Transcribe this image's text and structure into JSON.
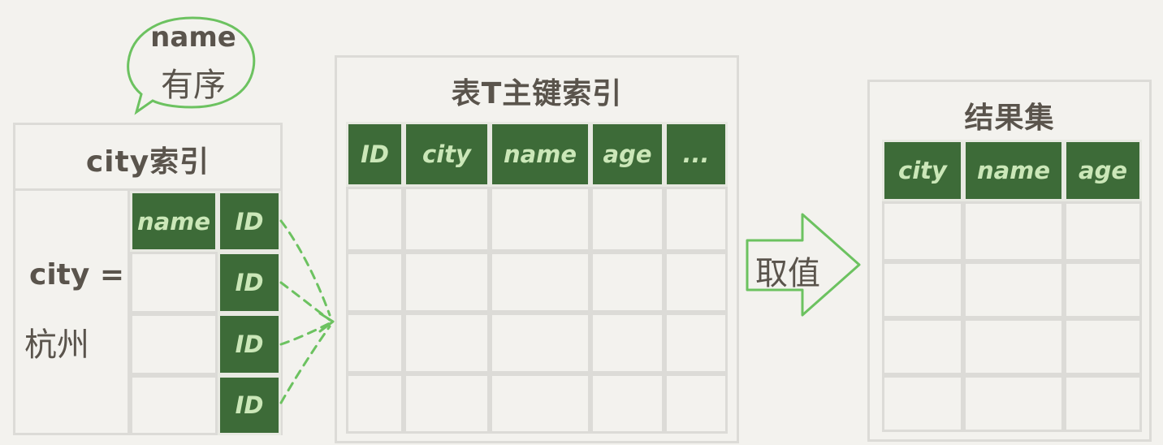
{
  "bubble": {
    "line1": "name",
    "line2": "有序"
  },
  "city_index": {
    "title": "city索引",
    "condition_line1": "city =",
    "condition_line2": "杭州",
    "header": [
      "name",
      "ID"
    ],
    "id_cells": [
      "ID",
      "ID",
      "ID"
    ]
  },
  "primary_index": {
    "title": "表T主键索引",
    "header": [
      "ID",
      "city",
      "name",
      "age",
      "..."
    ]
  },
  "arrow_label": "取值",
  "result_set": {
    "title": "结果集",
    "header": [
      "city",
      "name",
      "age"
    ]
  },
  "colors": {
    "header_green": "#3d6b38",
    "header_text": "#cbe7b8",
    "bubble_green": "#6cc260",
    "border": "#dcdbd7",
    "background": "#f3f2ee"
  }
}
